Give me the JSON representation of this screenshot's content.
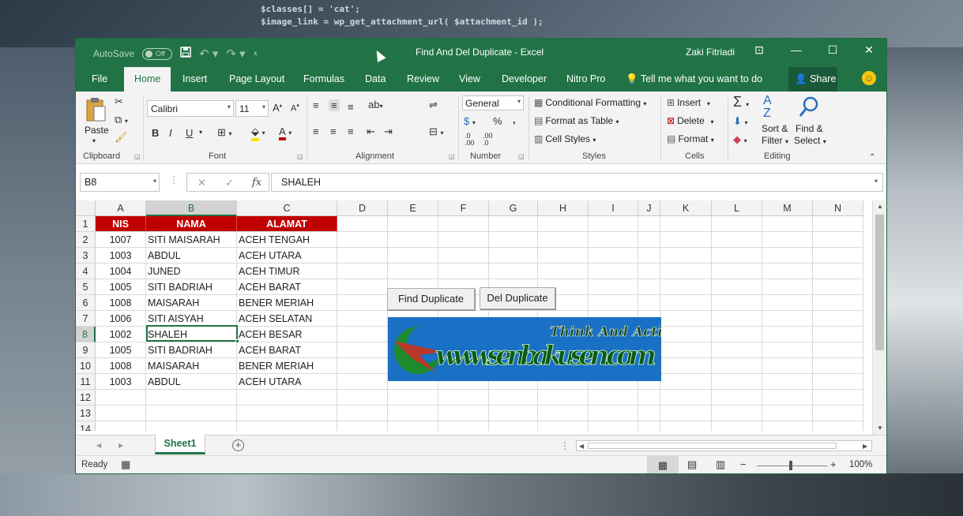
{
  "background_code": "$classes[] = 'cat';\n$image_link = wp_get_attachment_url( $attachment_id );",
  "titlebar": {
    "autosave_label": "AutoSave",
    "autosave_state": "Off",
    "title": "Find And Del Duplicate  -  Excel",
    "user": "Zaki Fitriadi"
  },
  "tabs": [
    "File",
    "Home",
    "Insert",
    "Page Layout",
    "Formulas",
    "Data",
    "Review",
    "View",
    "Developer",
    "Nitro Pro"
  ],
  "active_tab": "Home",
  "tell_me": "Tell me what you want to do",
  "share_label": "Share",
  "ribbon": {
    "clipboard": {
      "label": "Clipboard",
      "paste": "Paste"
    },
    "font": {
      "label": "Font",
      "name": "Calibri",
      "size": "11",
      "bold": "B",
      "italic": "I",
      "underline": "U"
    },
    "alignment": {
      "label": "Alignment"
    },
    "number": {
      "label": "Number",
      "format": "General",
      "percent": "%",
      "comma": ","
    },
    "styles": {
      "label": "Styles",
      "conditional": "Conditional Formatting",
      "table": "Format as Table",
      "cell_styles": "Cell Styles"
    },
    "cells": {
      "label": "Cells",
      "insert": "Insert",
      "delete": "Delete",
      "format": "Format"
    },
    "editing": {
      "label": "Editing",
      "sort": "Sort &",
      "sort2": "Filter",
      "find": "Find &",
      "find2": "Select"
    }
  },
  "formula_bar": {
    "name_box": "B8",
    "fx": "fx",
    "value": "SHALEH"
  },
  "columns": [
    "A",
    "B",
    "C",
    "D",
    "E",
    "F",
    "G",
    "H",
    "I",
    "J",
    "K",
    "L",
    "M",
    "N"
  ],
  "rows": [
    "1",
    "2",
    "3",
    "4",
    "5",
    "6",
    "7",
    "8",
    "9",
    "10",
    "11",
    "12",
    "13",
    "14"
  ],
  "table": {
    "headers": [
      "NIS",
      "NAMA",
      "ALAMAT"
    ],
    "records": [
      [
        "1007",
        "SITI MAISARAH",
        "ACEH TENGAH"
      ],
      [
        "1003",
        "ABDUL",
        "ACEH UTARA"
      ],
      [
        "1004",
        "JUNED",
        "ACEH TIMUR"
      ],
      [
        "1005",
        "SITI BADRIAH",
        "ACEH BARAT"
      ],
      [
        "1008",
        "MAISARAH",
        "BENER MERIAH"
      ],
      [
        "1006",
        "SITI AISYAH",
        "ACEH SELATAN"
      ],
      [
        "1002",
        "SHALEH",
        "ACEH BESAR"
      ],
      [
        "1005",
        "SITI BADRIAH",
        "ACEH BARAT"
      ],
      [
        "1008",
        "MAISARAH",
        "BENER MERIAH"
      ],
      [
        "1003",
        "ABDUL",
        "ACEH UTARA"
      ]
    ]
  },
  "buttons": {
    "find": "Find Duplicate",
    "del": "Del Duplicate"
  },
  "banner": {
    "site": "www.senbakusen.com",
    "slogan": "Think And Action"
  },
  "sheet_tab": "Sheet1",
  "status": {
    "ready": "Ready",
    "zoom": "100%"
  },
  "colors": {
    "excel_green": "#217346",
    "header_red": "#c00000",
    "banner_blue": "#1a70c4"
  }
}
